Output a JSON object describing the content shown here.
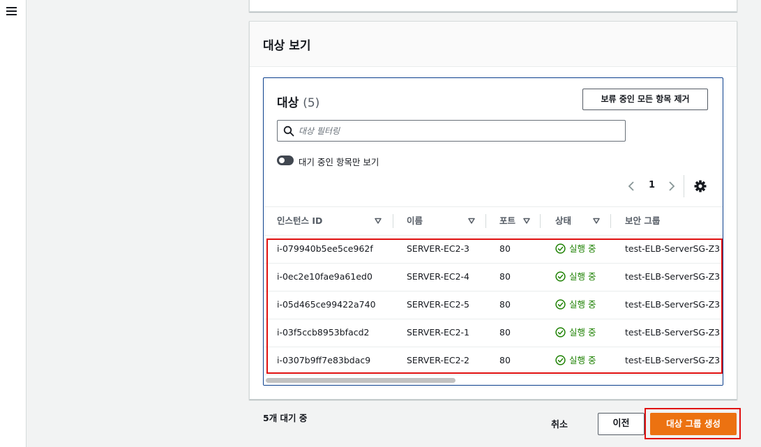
{
  "panel": {
    "title": "대상 보기"
  },
  "targets": {
    "title": "대상",
    "count": "(5)",
    "remove_all_label": "보류 중인 모든 항목 제거",
    "filter_placeholder": "대상 필터링",
    "toggle_label": "대기 중인 항목만 보기",
    "toggle_on": false,
    "page": "1"
  },
  "table": {
    "columns": [
      "인스턴스 ID",
      "이름",
      "포트",
      "상태",
      "보안 그룹"
    ],
    "rows": [
      {
        "id": "i-079940b5ee5ce962f",
        "name": "SERVER-EC2-3",
        "port": "80",
        "status": "실행 중",
        "sg": "test-ELB-ServerSG-Z3"
      },
      {
        "id": "i-0ec2e10fae9a61ed0",
        "name": "SERVER-EC2-4",
        "port": "80",
        "status": "실행 중",
        "sg": "test-ELB-ServerSG-Z3"
      },
      {
        "id": "i-05d465ce99422a740",
        "name": "SERVER-EC2-5",
        "port": "80",
        "status": "실행 중",
        "sg": "test-ELB-ServerSG-Z3"
      },
      {
        "id": "i-03f5ccb8953bfacd2",
        "name": "SERVER-EC2-1",
        "port": "80",
        "status": "실행 중",
        "sg": "test-ELB-ServerSG-Z3"
      },
      {
        "id": "i-0307b9ff7e83bdac9",
        "name": "SERVER-EC2-2",
        "port": "80",
        "status": "실행 중",
        "sg": "test-ELB-ServerSG-Z3"
      }
    ]
  },
  "footer": {
    "status": "5개 대기 중",
    "cancel_label": "취소",
    "previous_label": "이전",
    "create_label": "대상 그룹 생성"
  },
  "colors": {
    "primary": "#ec7211",
    "running": "#1d8102",
    "highlight": "#e01010",
    "focus_border": "#0a3e8c"
  },
  "icons": {
    "menu": "hamburger-icon",
    "search": "search-icon",
    "sort": "caret-down-icon",
    "status_ok": "check-circle-icon",
    "settings": "gear-icon",
    "prev": "chevron-left-icon",
    "next": "chevron-right-icon"
  }
}
